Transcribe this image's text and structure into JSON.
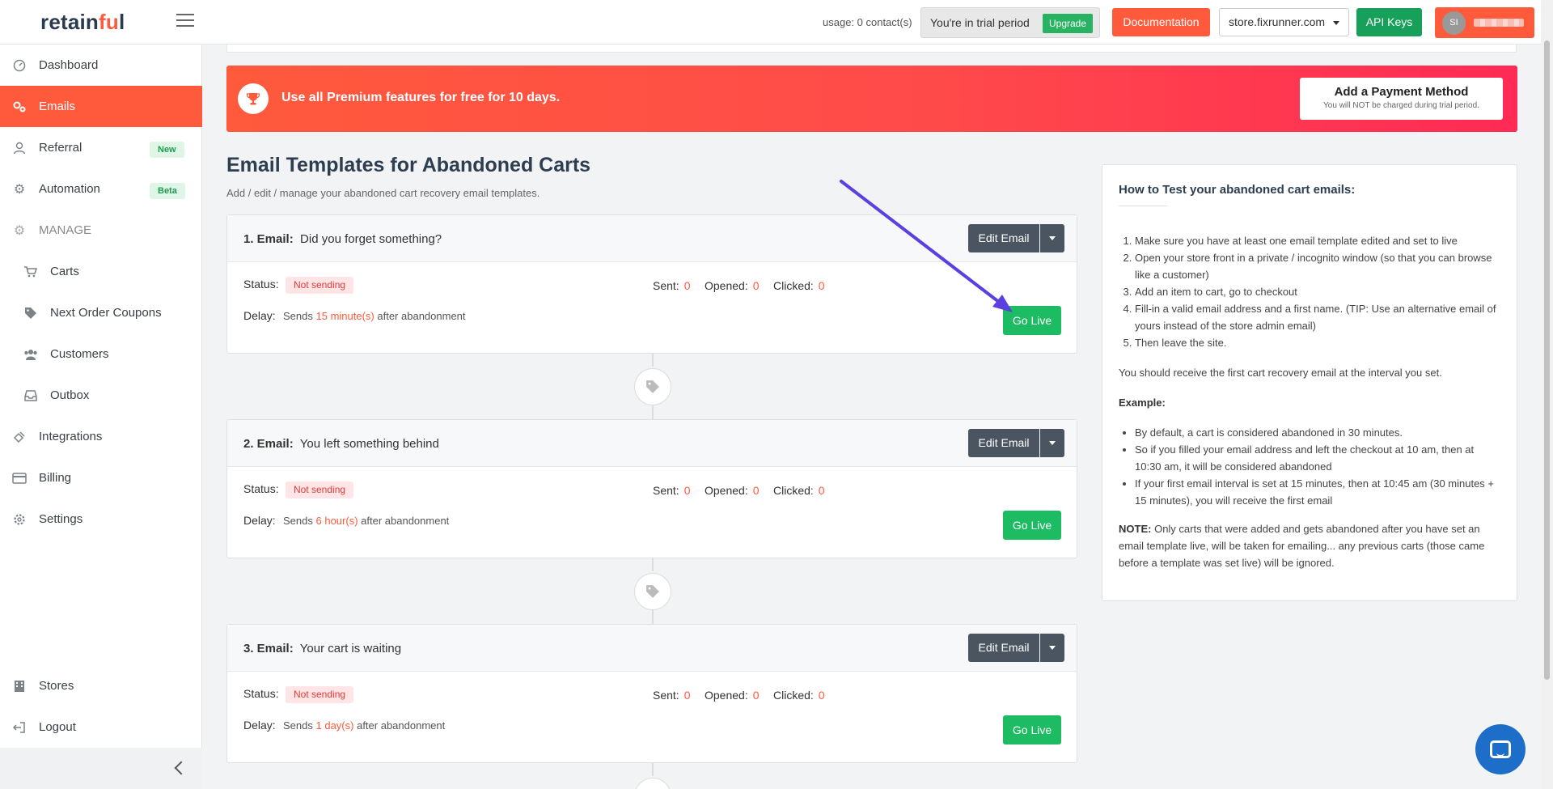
{
  "header": {
    "logo_main": "retain",
    "logo_accent": "fu",
    "logo_end": "l",
    "usage": "usage: 0 contact(s)",
    "trial_text": "You're in trial period",
    "upgrade_label": "Upgrade",
    "documentation_label": "Documentation",
    "store_selected": "store.fixrunner.com",
    "api_keys_label": "API Keys",
    "user_initials": "SI"
  },
  "sidebar": {
    "items": [
      {
        "label": "Dashboard",
        "icon": "dashboard-icon"
      },
      {
        "label": "Emails",
        "icon": "emails-icon"
      },
      {
        "label": "Referral",
        "icon": "referral-icon",
        "badge": "New"
      },
      {
        "label": "Automation",
        "icon": "automation-icon",
        "badge": "Beta"
      },
      {
        "label": "MANAGE",
        "icon": "gear-icon"
      },
      {
        "label": "Carts",
        "icon": "cart-icon"
      },
      {
        "label": "Next Order Coupons",
        "icon": "tags-icon"
      },
      {
        "label": "Customers",
        "icon": "users-icon"
      },
      {
        "label": "Outbox",
        "icon": "inbox-icon"
      },
      {
        "label": "Integrations",
        "icon": "plug-icon"
      },
      {
        "label": "Billing",
        "icon": "credit-card-icon"
      },
      {
        "label": "Settings",
        "icon": "settings-icon"
      },
      {
        "label": "Stores",
        "icon": "building-icon"
      },
      {
        "label": "Logout",
        "icon": "logout-icon"
      }
    ]
  },
  "promo": {
    "message": "Use all Premium features for free for 10 days.",
    "button_title": "Add a Payment Method",
    "button_sub": "You will NOT be charged during trial period."
  },
  "page": {
    "title": "Email Templates for Abandoned Carts",
    "subtitle": "Add / edit / manage your abandoned cart recovery email templates."
  },
  "emails": [
    {
      "label": "1. Email:",
      "subject": "Did you forget something?",
      "status": "Not sending",
      "delay_pre": "Sends",
      "delay_value": "15 minute(s)",
      "delay_post": "after abandonment",
      "sent": "0",
      "opened": "0",
      "clicked": "0"
    },
    {
      "label": "2. Email:",
      "subject": "You left something behind",
      "status": "Not sending",
      "delay_pre": "Sends",
      "delay_value": "6 hour(s)",
      "delay_post": "after abandonment",
      "sent": "0",
      "opened": "0",
      "clicked": "0"
    },
    {
      "label": "3. Email:",
      "subject": "Your cart is waiting",
      "status": "Not sending",
      "delay_pre": "Sends",
      "delay_value": "1 day(s)",
      "delay_post": "after abandonment",
      "sent": "0",
      "opened": "0",
      "clicked": "0"
    }
  ],
  "labels": {
    "edit_email": "Edit Email",
    "go_live": "Go Live",
    "status": "Status:",
    "delay": "Delay:",
    "sent": "Sent:",
    "opened": "Opened:",
    "clicked": "Clicked:"
  },
  "help": {
    "title": "How to Test your abandoned cart emails:",
    "steps": [
      "Make sure you have at least one email template edited and set to live",
      "Open your store front in a private / incognito window (so that you can browse like a customer)",
      "Add an item to cart, go to checkout",
      "Fill-in a valid email address and a first name. (TIP: Use an alternative email of yours instead of the store admin email)",
      "Then leave the site."
    ],
    "note1": "You should receive the first cart recovery email at the interval you set.",
    "example_label": "Example:",
    "examples": [
      "By default, a cart is considered abandoned in 30 minutes.",
      "So if you filled your email address and left the checkout at 10 am, then at 10:30 am, it will be considered abandoned",
      "If your first email interval is set at 15 minutes, then at 10:45 am (30 minutes + 15 minutes), you will receive the first email"
    ],
    "note_label": "NOTE:",
    "note_text": "Only carts that were added and gets abandoned after you have set an email template live, will be taken for emailing... any previous carts (those came before a template was set live) will be ignored."
  },
  "colors": {
    "accent": "#ff5a3c",
    "success": "#1dbb62",
    "dark_button": "#4a5561",
    "annotation_arrow": "#5b3fe0"
  }
}
